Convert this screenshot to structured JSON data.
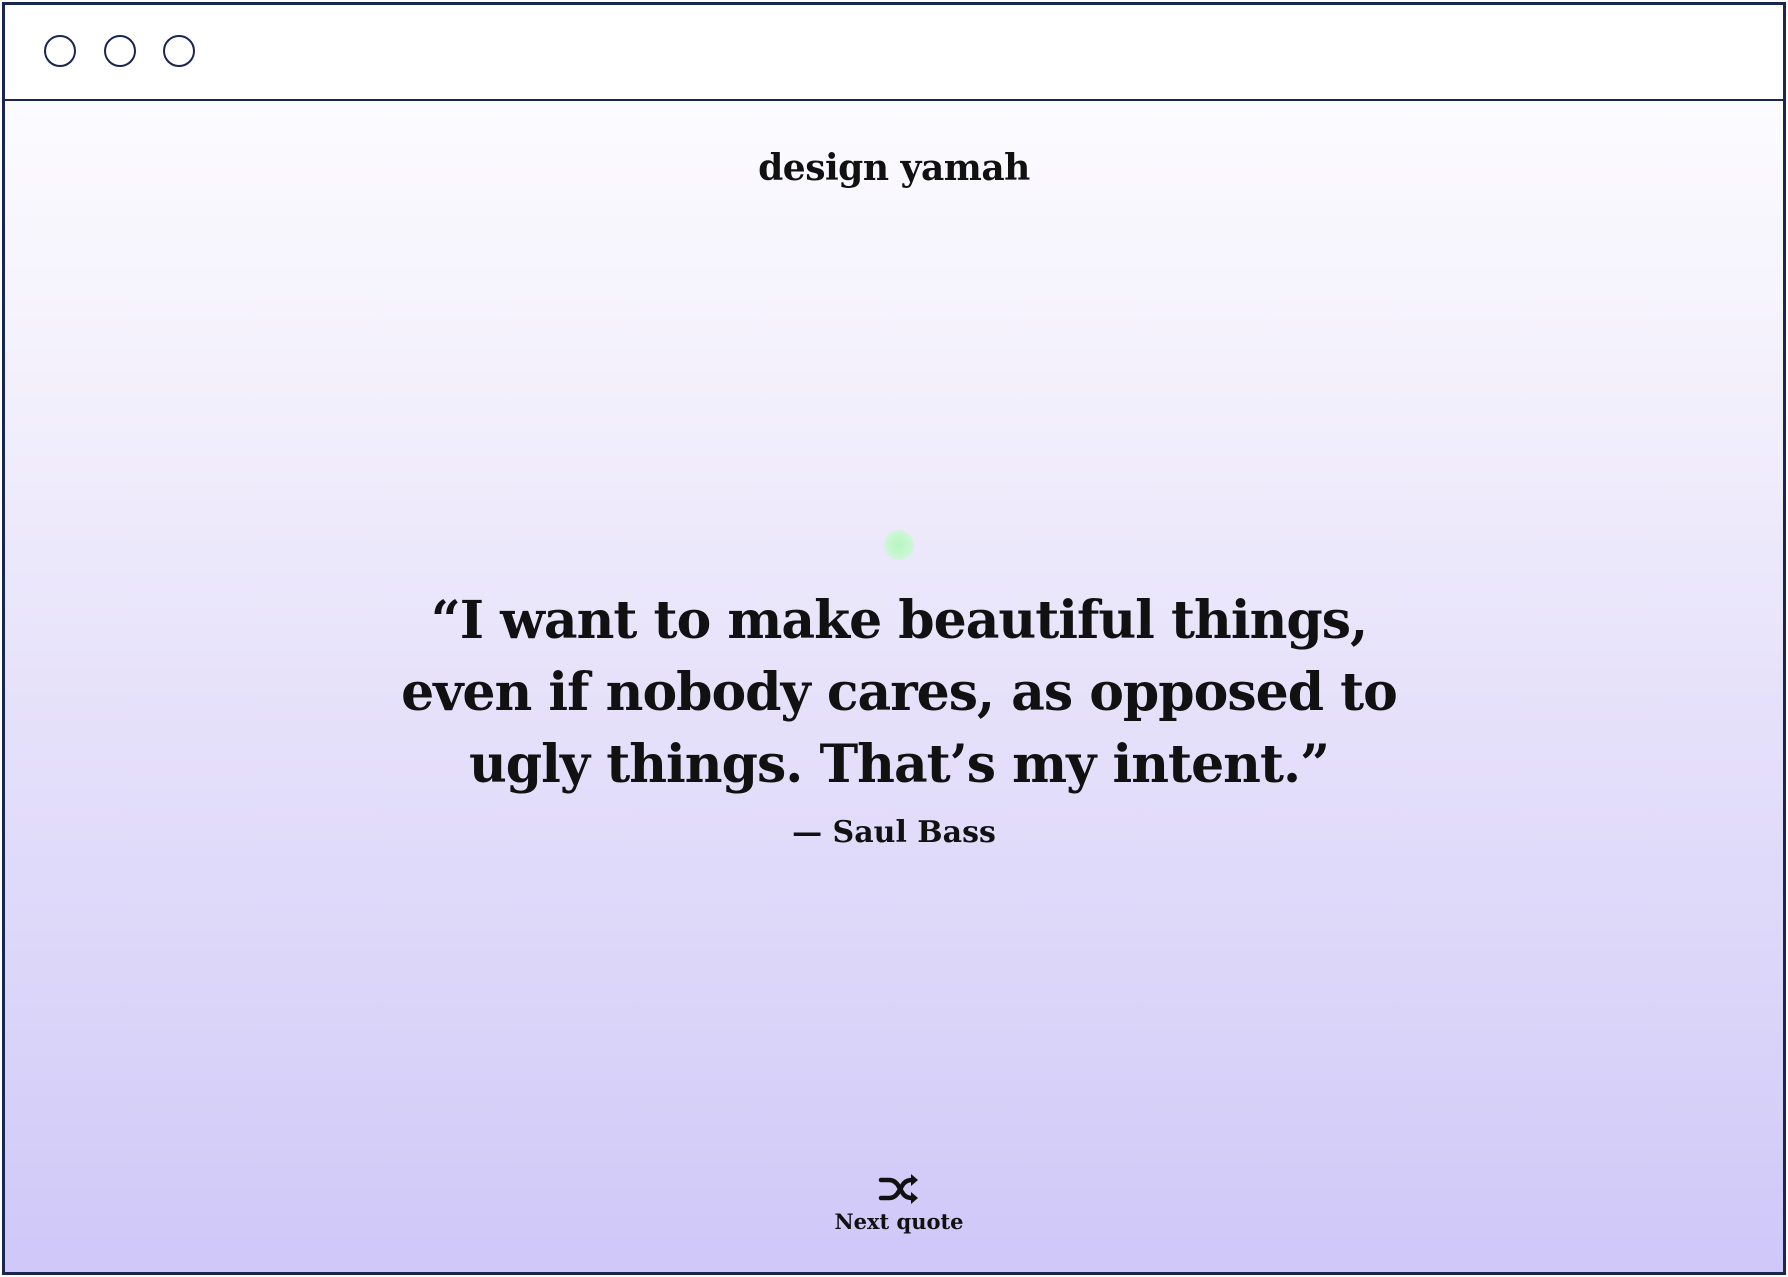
{
  "window": {
    "controls": [
      "window-control-1",
      "window-control-2",
      "window-control-3"
    ]
  },
  "header": {
    "brand": "design yamah"
  },
  "quote": {
    "text": "“I want to make beautiful things, even if nobody cares, as opposed to ugly things. That’s my intent.”",
    "author": "— Saul Bass"
  },
  "actions": {
    "next_label": "Next quote",
    "next_icon": "shuffle-icon"
  },
  "colors": {
    "border": "#1a2550",
    "text": "#111111",
    "gradient_top": "#ffffff",
    "gradient_bottom": "#cfc7f8",
    "indicator": "#b6f5c2"
  }
}
